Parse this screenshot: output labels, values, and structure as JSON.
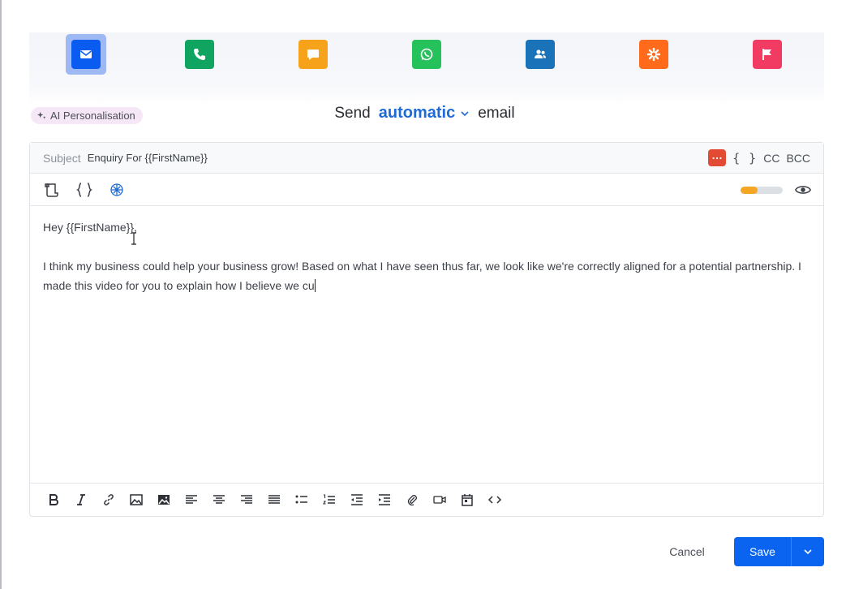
{
  "steps": [
    {
      "name": "email",
      "color": "#0a5cf0",
      "active": true
    },
    {
      "name": "phone",
      "color": "#0fa560"
    },
    {
      "name": "sms",
      "color": "#f7a21b"
    },
    {
      "name": "whatsapp",
      "color": "#25c15a"
    },
    {
      "name": "contacts",
      "color": "#1a73b8"
    },
    {
      "name": "zapier",
      "color": "#ff6b1a"
    },
    {
      "name": "flag",
      "color": "#f13b63"
    }
  ],
  "ai_chip": {
    "label": "AI Personalisation"
  },
  "send_line": {
    "prefix": "Send",
    "mode": "automatic",
    "suffix": "email"
  },
  "subject": {
    "label": "Subject",
    "value": "Enquiry For {{FirstName}}"
  },
  "subject_actions": {
    "braces": "{ }",
    "cc": "CC",
    "bcc": "BCC",
    "badge_color": "#e24a33"
  },
  "score": {
    "percent": 40,
    "color": "#f5a623"
  },
  "body": {
    "greeting": "Hey {{FirstName}},",
    "paragraph": "I think my business could help your business grow! Based on what I have seen thus far, we look like we're correctly aligned for a potential partnership. I made this video for you to explain how I believe we cu"
  },
  "footer": {
    "cancel": "Cancel",
    "save": "Save"
  },
  "accent": "#0a64f0"
}
